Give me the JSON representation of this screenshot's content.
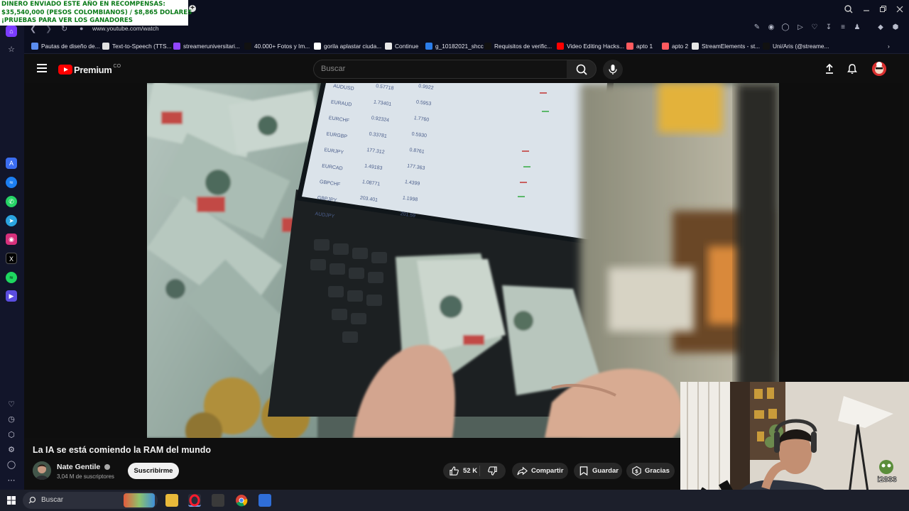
{
  "stream_overlay": {
    "line1": "DINERO ENVIADO ESTE AÑO EN RECOMPENSAS:",
    "line2": " $35,540,000 (PESOS COLOMBIANOS) / $8,865 DOLARES",
    "line3": "¡PRUEBAS PARA VER LOS GANADORES"
  },
  "browser": {
    "new_tab": "+",
    "url": "www.youtube.com/watch",
    "bookmarks": [
      {
        "label": "Pautas de diseño de...",
        "color": "#5b8def"
      },
      {
        "label": "Text-to-Speech (TTS...",
        "color": "#e0e0e0"
      },
      {
        "label": "streameruniversitari...",
        "color": "#9146ff"
      },
      {
        "label": "40.000+ Fotos y Im...",
        "color": "#111111"
      },
      {
        "label": "gorila aplastar ciuda...",
        "color": "#ffffff"
      },
      {
        "label": "Continue",
        "color": "#e8e8e8"
      },
      {
        "label": "g_10182021_shcc",
        "color": "#2b7de9"
      },
      {
        "label": "Requisitos de verific...",
        "color": "#111111"
      },
      {
        "label": "Video Editing Hacks...",
        "color": "#ff0000"
      },
      {
        "label": "apto 1",
        "color": "#ff5a5f"
      },
      {
        "label": "apto 2",
        "color": "#ff5a5f"
      },
      {
        "label": "StreamElements - st...",
        "color": "#e6e6e6"
      },
      {
        "label": "Uni/Aris (@streame...",
        "color": "#111111"
      }
    ]
  },
  "youtube": {
    "logo_text": "Premium",
    "country_code": "CO",
    "search_placeholder": "Buscar",
    "video_title": "La IA se está comiendo la RAM del mundo",
    "channel_name": "Nate Gentile",
    "subscribers": "3,04 M de suscriptores",
    "subscribe_label": "Suscribirme",
    "likes": "52 K",
    "share_label": "Compartir",
    "save_label": "Guardar",
    "thanks_label": "Gracias"
  },
  "video_frame": {
    "pairs": [
      "AUDUSD",
      "EURAUD",
      "EURCHF",
      "EURGBP",
      "EURJPY",
      "EURCAD",
      "GBPCHF",
      "GBPJPY",
      "AUDJPY"
    ],
    "col1": [
      "0.57718",
      "1.73401",
      "0.92324",
      "0.33781",
      "177.312",
      "1.49183",
      "1.08771",
      "203.401",
      ""
    ],
    "col2": [
      "0.9922",
      "0.5953",
      "1.7760",
      "0.5930",
      "0.8761",
      "177.363",
      "1.4399",
      "1.1998",
      "201.59"
    ]
  },
  "webcam": {
    "emote_text": "i2833"
  },
  "taskbar": {
    "search_label": "Buscar"
  },
  "colors": {
    "youtube_red": "#ff0000",
    "overlay_green": "#0a7a18",
    "browser_bg": "#0b0e1e"
  }
}
